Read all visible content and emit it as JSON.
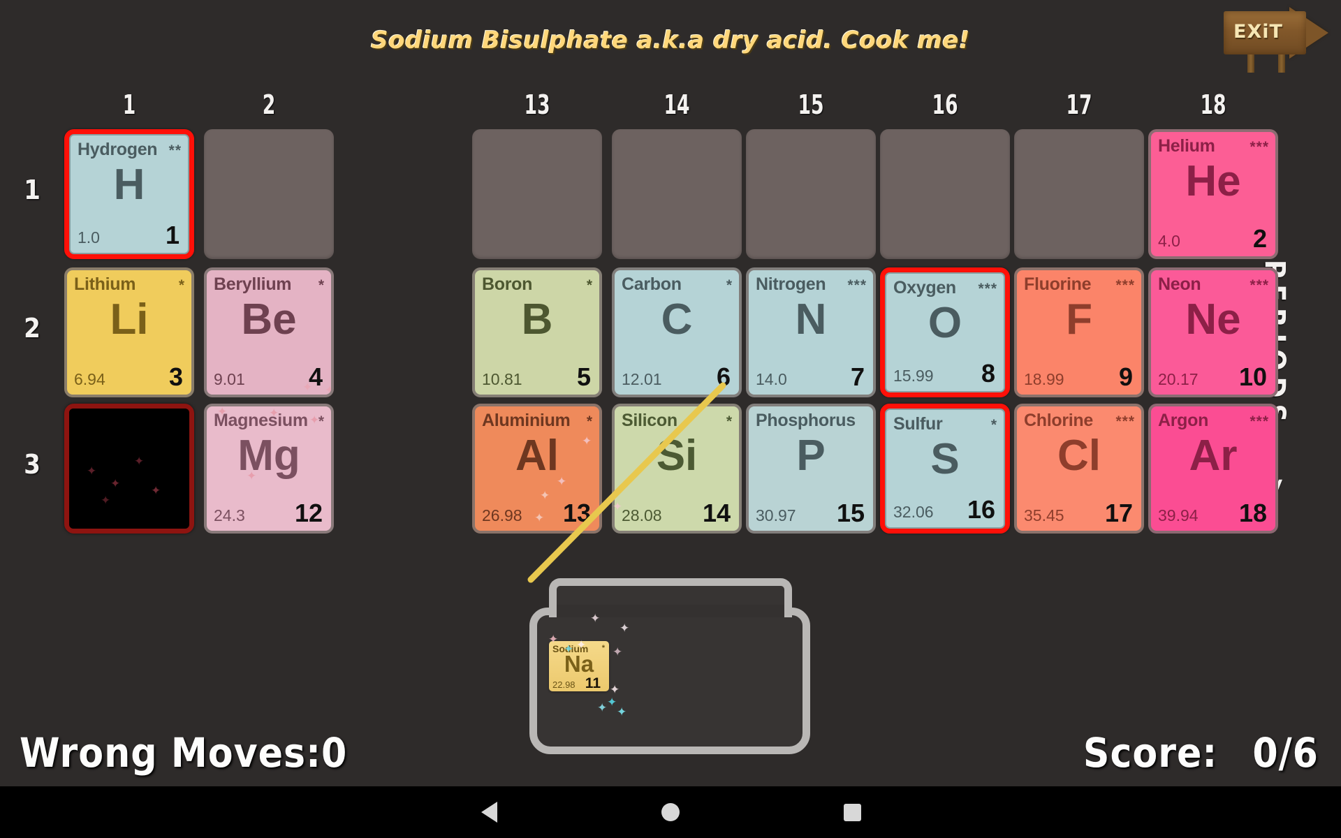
{
  "title": "Sodium Bisulphate a.k.a dry acid. Cook me!",
  "exit": {
    "label": "EXiT"
  },
  "axis": {
    "groups": [
      "1",
      "2",
      "13",
      "14",
      "15",
      "16",
      "17",
      "18"
    ],
    "periods": [
      "1",
      "2",
      "3"
    ],
    "periods_label": "PERIODS -->"
  },
  "elements": [
    {
      "name": "Hydrogen",
      "symbol": "H",
      "mass": "1.0",
      "number": "1",
      "stars": "**",
      "row": 1,
      "col": 1,
      "bg": "#b5d3d6",
      "fg": "#4a5c60",
      "state": "highlight"
    },
    {
      "name": "Helium",
      "symbol": "He",
      "mass": "4.0",
      "number": "2",
      "stars": "***",
      "row": 1,
      "col": 18,
      "bg": "#fc5e95",
      "fg": "#8c2047",
      "state": "normal"
    },
    {
      "name": "Lithium",
      "symbol": "Li",
      "mass": "6.94",
      "number": "3",
      "stars": "*",
      "row": 2,
      "col": 1,
      "bg": "#f0cc5c",
      "fg": "#7a6019",
      "state": "normal"
    },
    {
      "name": "Beryllium",
      "symbol": "Be",
      "mass": "9.01",
      "number": "4",
      "stars": "*",
      "row": 2,
      "col": 2,
      "bg": "#e4b3c4",
      "fg": "#6e4150",
      "state": "normal"
    },
    {
      "name": "Boron",
      "symbol": "B",
      "mass": "10.81",
      "number": "5",
      "stars": "*",
      "row": 2,
      "col": 13,
      "bg": "#cdd6a7",
      "fg": "#4d5730",
      "state": "normal"
    },
    {
      "name": "Carbon",
      "symbol": "C",
      "mass": "12.01",
      "number": "6",
      "stars": "*",
      "row": 2,
      "col": 14,
      "bg": "#b5d3d6",
      "fg": "#4a5c60",
      "state": "normal"
    },
    {
      "name": "Nitrogen",
      "symbol": "N",
      "mass": "14.0",
      "number": "7",
      "stars": "***",
      "row": 2,
      "col": 15,
      "bg": "#b5d3d6",
      "fg": "#4a5c60",
      "state": "normal"
    },
    {
      "name": "Oxygen",
      "symbol": "O",
      "mass": "15.99",
      "number": "8",
      "stars": "***",
      "row": 2,
      "col": 16,
      "bg": "#b5d3d6",
      "fg": "#4a5c60",
      "state": "highlight"
    },
    {
      "name": "Fluorine",
      "symbol": "F",
      "mass": "18.99",
      "number": "9",
      "stars": "***",
      "row": 2,
      "col": 17,
      "bg": "#fb8469",
      "fg": "#8e3e2c",
      "state": "normal"
    },
    {
      "name": "Neon",
      "symbol": "Ne",
      "mass": "20.17",
      "number": "10",
      "stars": "***",
      "row": 2,
      "col": 18,
      "bg": "#fb5a98",
      "fg": "#8c2047",
      "state": "normal"
    },
    {
      "name": "Sodium",
      "symbol": "Na",
      "mass": "22.98",
      "number": "11",
      "stars": "*",
      "row": 3,
      "col": 1,
      "bg": "#000000",
      "fg": "#000000",
      "state": "locked"
    },
    {
      "name": "Magnesium",
      "symbol": "Mg",
      "mass": "24.3",
      "number": "12",
      "stars": "*",
      "row": 3,
      "col": 2,
      "bg": "#e9bbcb",
      "fg": "#7b5060",
      "state": "normal"
    },
    {
      "name": "Aluminium",
      "symbol": "Al",
      "mass": "26.98",
      "number": "13",
      "stars": "*",
      "row": 3,
      "col": 13,
      "bg": "#ef8a5b",
      "fg": "#6e3720",
      "state": "normal"
    },
    {
      "name": "Silicon",
      "symbol": "Si",
      "mass": "28.08",
      "number": "14",
      "stars": "*",
      "row": 3,
      "col": 14,
      "bg": "#cdd9ab",
      "fg": "#4c5a33",
      "state": "normal"
    },
    {
      "name": "Phosphorus",
      "symbol": "P",
      "mass": "30.97",
      "number": "15",
      "stars": "",
      "row": 3,
      "col": 15,
      "bg": "#b9d3d4",
      "fg": "#4a5c60",
      "state": "normal"
    },
    {
      "name": "Sulfur",
      "symbol": "S",
      "mass": "32.06",
      "number": "16",
      "stars": "*",
      "row": 3,
      "col": 16,
      "bg": "#b5d3d6",
      "fg": "#4a5c60",
      "state": "highlight"
    },
    {
      "name": "Chlorine",
      "symbol": "Cl",
      "mass": "35.45",
      "number": "17",
      "stars": "***",
      "row": 3,
      "col": 17,
      "bg": "#fb8a6f",
      "fg": "#8e3e2c",
      "state": "normal"
    },
    {
      "name": "Argon",
      "symbol": "Ar",
      "mass": "39.94",
      "number": "18",
      "stars": "***",
      "row": 3,
      "col": 18,
      "bg": "#fb4d93",
      "fg": "#8c2047",
      "state": "normal"
    }
  ],
  "empty_cells": [
    {
      "row": 1,
      "col": 2
    },
    {
      "row": 1,
      "col": 13
    },
    {
      "row": 1,
      "col": 14
    },
    {
      "row": 1,
      "col": 15
    },
    {
      "row": 1,
      "col": 16
    },
    {
      "row": 1,
      "col": 17
    },
    {
      "row": 2,
      "col": 13
    },
    {
      "row": 3,
      "col": 13
    }
  ],
  "jar_tile": {
    "name": "Sodium",
    "symbol": "Na",
    "mass": "22.98",
    "number": "11",
    "stars": "*"
  },
  "hud": {
    "wrong_moves_label": "Wrong Moves:",
    "wrong_moves_value": "0",
    "score_label": "Score:",
    "score_value": "0/6"
  },
  "navbar": {
    "back": "back-triangle",
    "home": "home-circle",
    "recent": "recent-square"
  },
  "colors": {
    "background": "#2e2b2a",
    "highlight": "#ff1008",
    "locked_border": "#8e1410",
    "title": "#ffd77a",
    "trajectory": "#e8c84e"
  }
}
